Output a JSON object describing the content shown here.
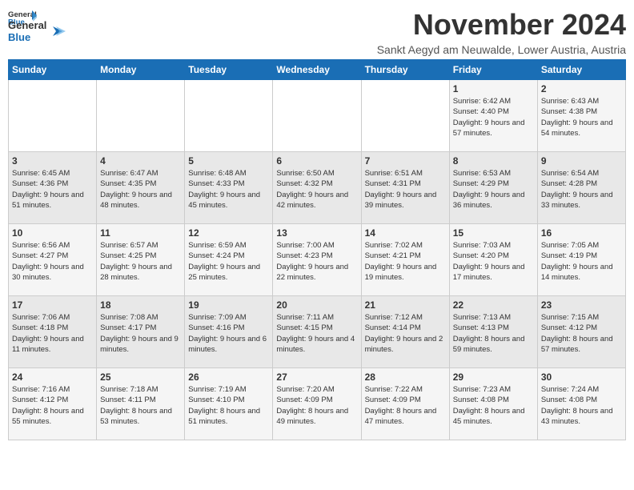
{
  "header": {
    "logo_line1": "General",
    "logo_line2": "Blue",
    "month": "November 2024",
    "location": "Sankt Aegyd am Neuwalde, Lower Austria, Austria"
  },
  "weekdays": [
    "Sunday",
    "Monday",
    "Tuesday",
    "Wednesday",
    "Thursday",
    "Friday",
    "Saturday"
  ],
  "weeks": [
    [
      {
        "day": "",
        "info": ""
      },
      {
        "day": "",
        "info": ""
      },
      {
        "day": "",
        "info": ""
      },
      {
        "day": "",
        "info": ""
      },
      {
        "day": "",
        "info": ""
      },
      {
        "day": "1",
        "info": "Sunrise: 6:42 AM\nSunset: 4:40 PM\nDaylight: 9 hours and 57 minutes."
      },
      {
        "day": "2",
        "info": "Sunrise: 6:43 AM\nSunset: 4:38 PM\nDaylight: 9 hours and 54 minutes."
      }
    ],
    [
      {
        "day": "3",
        "info": "Sunrise: 6:45 AM\nSunset: 4:36 PM\nDaylight: 9 hours and 51 minutes."
      },
      {
        "day": "4",
        "info": "Sunrise: 6:47 AM\nSunset: 4:35 PM\nDaylight: 9 hours and 48 minutes."
      },
      {
        "day": "5",
        "info": "Sunrise: 6:48 AM\nSunset: 4:33 PM\nDaylight: 9 hours and 45 minutes."
      },
      {
        "day": "6",
        "info": "Sunrise: 6:50 AM\nSunset: 4:32 PM\nDaylight: 9 hours and 42 minutes."
      },
      {
        "day": "7",
        "info": "Sunrise: 6:51 AM\nSunset: 4:31 PM\nDaylight: 9 hours and 39 minutes."
      },
      {
        "day": "8",
        "info": "Sunrise: 6:53 AM\nSunset: 4:29 PM\nDaylight: 9 hours and 36 minutes."
      },
      {
        "day": "9",
        "info": "Sunrise: 6:54 AM\nSunset: 4:28 PM\nDaylight: 9 hours and 33 minutes."
      }
    ],
    [
      {
        "day": "10",
        "info": "Sunrise: 6:56 AM\nSunset: 4:27 PM\nDaylight: 9 hours and 30 minutes."
      },
      {
        "day": "11",
        "info": "Sunrise: 6:57 AM\nSunset: 4:25 PM\nDaylight: 9 hours and 28 minutes."
      },
      {
        "day": "12",
        "info": "Sunrise: 6:59 AM\nSunset: 4:24 PM\nDaylight: 9 hours and 25 minutes."
      },
      {
        "day": "13",
        "info": "Sunrise: 7:00 AM\nSunset: 4:23 PM\nDaylight: 9 hours and 22 minutes."
      },
      {
        "day": "14",
        "info": "Sunrise: 7:02 AM\nSunset: 4:21 PM\nDaylight: 9 hours and 19 minutes."
      },
      {
        "day": "15",
        "info": "Sunrise: 7:03 AM\nSunset: 4:20 PM\nDaylight: 9 hours and 17 minutes."
      },
      {
        "day": "16",
        "info": "Sunrise: 7:05 AM\nSunset: 4:19 PM\nDaylight: 9 hours and 14 minutes."
      }
    ],
    [
      {
        "day": "17",
        "info": "Sunrise: 7:06 AM\nSunset: 4:18 PM\nDaylight: 9 hours and 11 minutes."
      },
      {
        "day": "18",
        "info": "Sunrise: 7:08 AM\nSunset: 4:17 PM\nDaylight: 9 hours and 9 minutes."
      },
      {
        "day": "19",
        "info": "Sunrise: 7:09 AM\nSunset: 4:16 PM\nDaylight: 9 hours and 6 minutes."
      },
      {
        "day": "20",
        "info": "Sunrise: 7:11 AM\nSunset: 4:15 PM\nDaylight: 9 hours and 4 minutes."
      },
      {
        "day": "21",
        "info": "Sunrise: 7:12 AM\nSunset: 4:14 PM\nDaylight: 9 hours and 2 minutes."
      },
      {
        "day": "22",
        "info": "Sunrise: 7:13 AM\nSunset: 4:13 PM\nDaylight: 8 hours and 59 minutes."
      },
      {
        "day": "23",
        "info": "Sunrise: 7:15 AM\nSunset: 4:12 PM\nDaylight: 8 hours and 57 minutes."
      }
    ],
    [
      {
        "day": "24",
        "info": "Sunrise: 7:16 AM\nSunset: 4:12 PM\nDaylight: 8 hours and 55 minutes."
      },
      {
        "day": "25",
        "info": "Sunrise: 7:18 AM\nSunset: 4:11 PM\nDaylight: 8 hours and 53 minutes."
      },
      {
        "day": "26",
        "info": "Sunrise: 7:19 AM\nSunset: 4:10 PM\nDaylight: 8 hours and 51 minutes."
      },
      {
        "day": "27",
        "info": "Sunrise: 7:20 AM\nSunset: 4:09 PM\nDaylight: 8 hours and 49 minutes."
      },
      {
        "day": "28",
        "info": "Sunrise: 7:22 AM\nSunset: 4:09 PM\nDaylight: 8 hours and 47 minutes."
      },
      {
        "day": "29",
        "info": "Sunrise: 7:23 AM\nSunset: 4:08 PM\nDaylight: 8 hours and 45 minutes."
      },
      {
        "day": "30",
        "info": "Sunrise: 7:24 AM\nSunset: 4:08 PM\nDaylight: 8 hours and 43 minutes."
      }
    ]
  ]
}
